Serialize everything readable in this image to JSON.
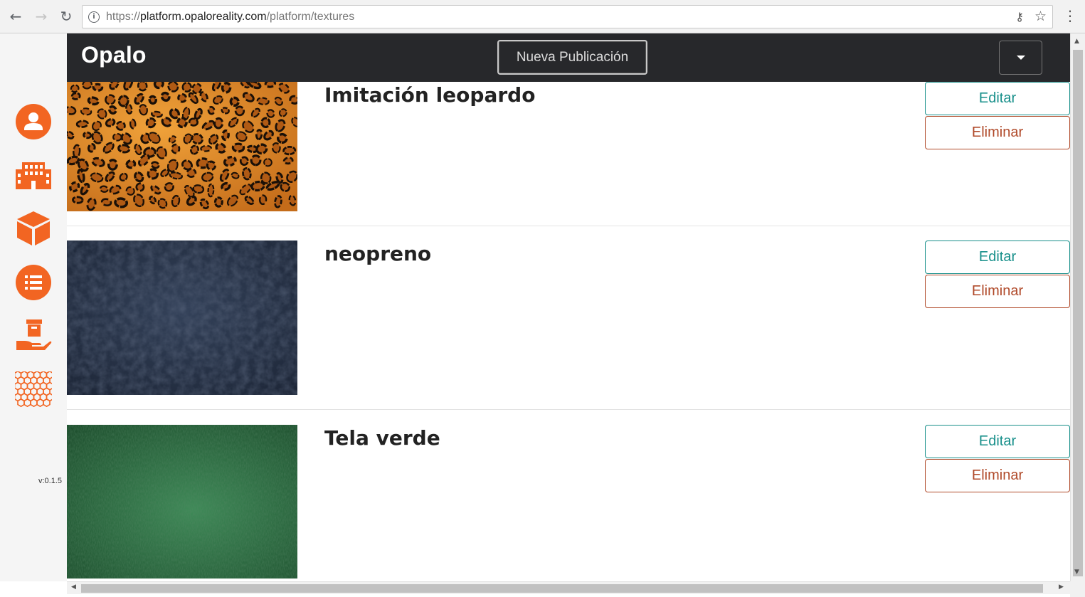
{
  "browser": {
    "url_prefix": "https://",
    "url_host": "platform.opaloreality.com",
    "url_path": "/platform/textures",
    "back_glyph": "←",
    "forward_glyph": "→",
    "reload_glyph": "↻",
    "info_glyph": "i",
    "key_glyph": "⚷",
    "star_glyph": "☆",
    "menu_glyph": "⋮"
  },
  "sidebar": {
    "items": [
      {
        "name": "user-icon"
      },
      {
        "name": "building-icon"
      },
      {
        "name": "cube-icon"
      },
      {
        "name": "list-icon"
      },
      {
        "name": "hand-box-icon"
      },
      {
        "name": "honeycomb-icon"
      }
    ],
    "version": "v:0.1.5",
    "accent": "#f26522"
  },
  "navbar": {
    "brand": "Opalo",
    "new_publication_label": "Nueva Publicación",
    "background": "#27282b"
  },
  "textures": [
    {
      "title": "Imitación leopardo",
      "edit_label": "Editar",
      "delete_label": "Eliminar"
    },
    {
      "title": "neopreno",
      "edit_label": "Editar",
      "delete_label": "Eliminar"
    },
    {
      "title": "Tela verde",
      "edit_label": "Editar",
      "delete_label": "Eliminar"
    }
  ],
  "colors": {
    "edit": "#178f8a",
    "delete": "#b04a2a"
  }
}
